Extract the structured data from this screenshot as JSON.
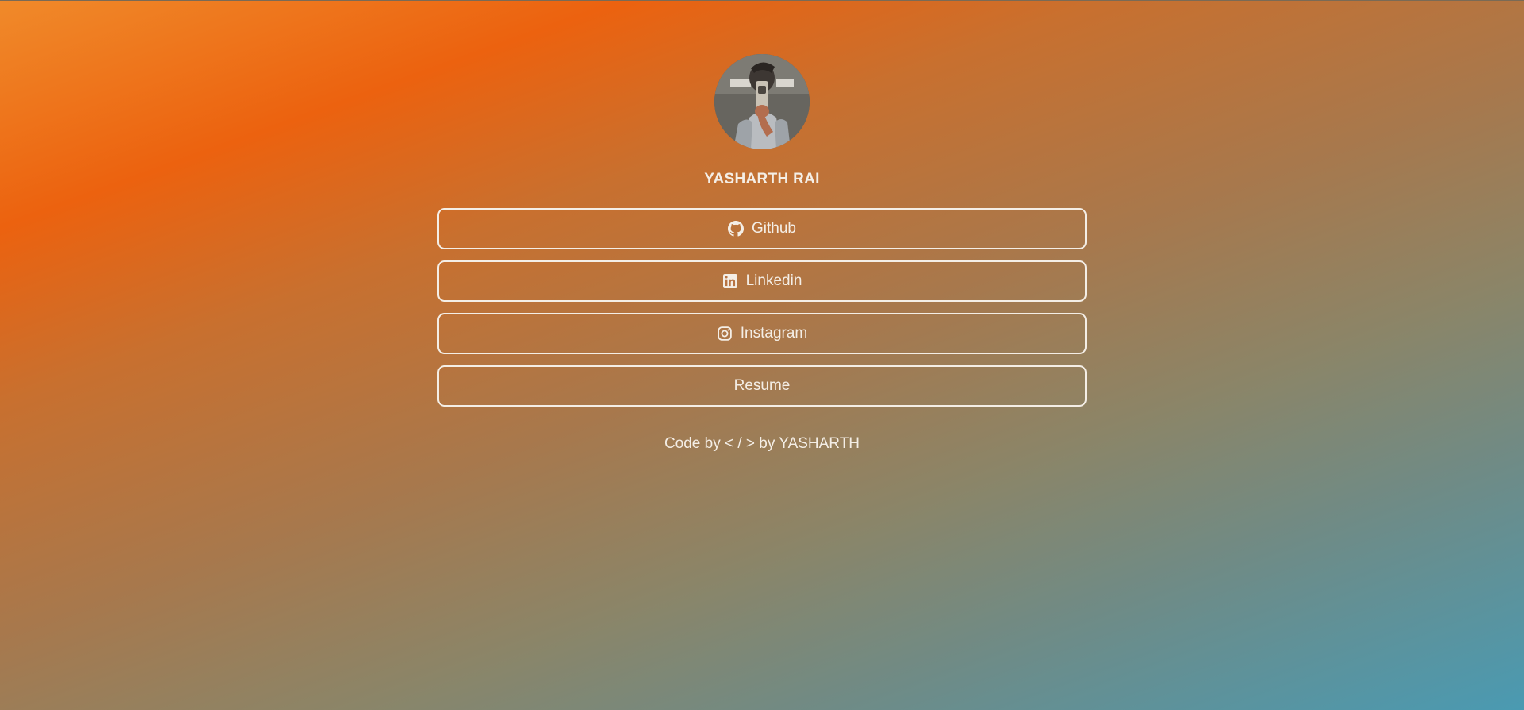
{
  "profile": {
    "name": "YASHARTH RAI"
  },
  "links": [
    {
      "label": "Github",
      "icon": "github-icon"
    },
    {
      "label": "Linkedin",
      "icon": "linkedin-icon"
    },
    {
      "label": "Instagram",
      "icon": "instagram-icon"
    },
    {
      "label": "Resume",
      "icon": ""
    }
  ],
  "footer": {
    "text": "Code by < / > by YASHARTH"
  },
  "colors": {
    "gradient_top": "#ec620f",
    "gradient_bottom": "#4a9ab2",
    "text": "#f4eee6"
  }
}
